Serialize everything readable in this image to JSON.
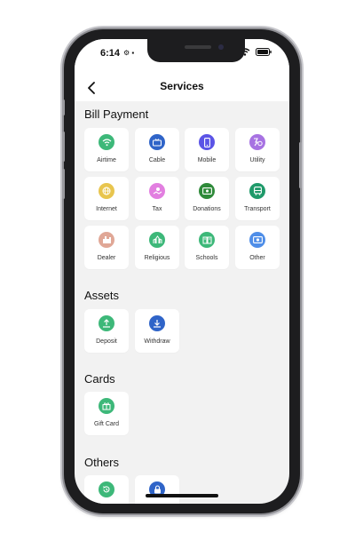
{
  "status": {
    "time": "6:14",
    "extra": "⚙ ▪"
  },
  "header": {
    "title": "Services",
    "back_label": "back"
  },
  "sections": [
    {
      "title": "Bill Payment",
      "items": [
        {
          "label": "Airtime",
          "color": "#3db879",
          "icon": "wifi-icon"
        },
        {
          "label": "Cable",
          "color": "#2f64c8",
          "icon": "tv-icon"
        },
        {
          "label": "Mobile",
          "color": "#5b54e6",
          "icon": "phone-icon"
        },
        {
          "label": "Utility",
          "color": "#a772e2",
          "icon": "utility-icon"
        },
        {
          "label": "Internet",
          "color": "#e8c54e",
          "icon": "globe-icon"
        },
        {
          "label": "Tax",
          "color": "#e27fe0",
          "icon": "tax-icon"
        },
        {
          "label": "Donations",
          "color": "#2f8a3a",
          "icon": "money-icon"
        },
        {
          "label": "Transport",
          "color": "#1f9a6a",
          "icon": "bus-icon"
        },
        {
          "label": "Dealer",
          "color": "#e0a796",
          "icon": "store-icon"
        },
        {
          "label": "Religious",
          "color": "#3db879",
          "icon": "church-icon"
        },
        {
          "label": "Schools",
          "color": "#3db879",
          "icon": "school-icon"
        },
        {
          "label": "Other",
          "color": "#4f8ee8",
          "icon": "other-icon"
        }
      ]
    },
    {
      "title": "Assets",
      "items": [
        {
          "label": "Deposit",
          "color": "#3db879",
          "icon": "upload-icon"
        },
        {
          "label": "Withdraw",
          "color": "#2f64c8",
          "icon": "download-icon"
        }
      ]
    },
    {
      "title": "Cards",
      "items": [
        {
          "label": "Gift Card",
          "color": "#3db879",
          "icon": "gift-icon"
        }
      ]
    },
    {
      "title": "Others",
      "items": [
        {
          "label": "",
          "color": "#3db879",
          "icon": "history-icon"
        },
        {
          "label": "",
          "color": "#2f64c8",
          "icon": "lock-icon"
        }
      ]
    }
  ]
}
